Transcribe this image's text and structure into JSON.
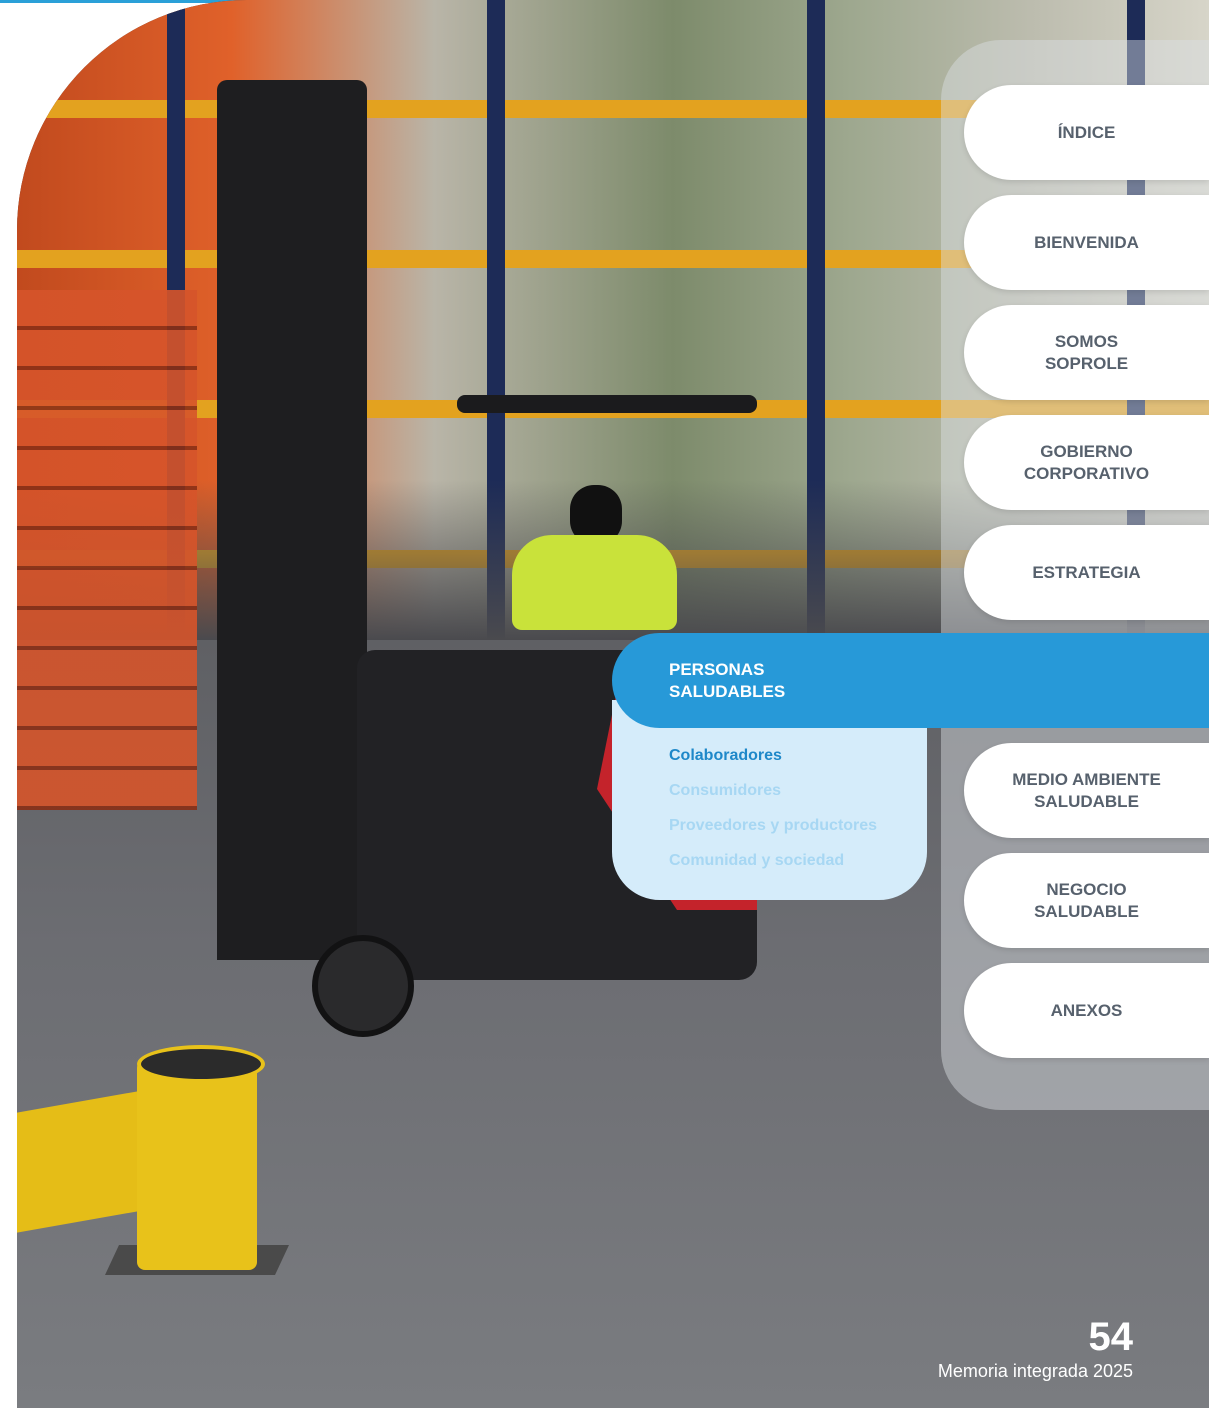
{
  "nav": {
    "items": [
      {
        "label": "ÍNDICE"
      },
      {
        "label": "BIENVENIDA"
      },
      {
        "label": "SOMOS\nSOPROLE"
      },
      {
        "label": "GOBIERNO\nCORPORATIVO"
      },
      {
        "label": "ESTRATEGIA"
      },
      {
        "label": "MEDIO AMBIENTE\nSALUDABLE"
      },
      {
        "label": "NEGOCIO\nSALUDABLE"
      },
      {
        "label": "ANEXOS"
      }
    ],
    "active": {
      "label": "PERSONAS\nSALUDABLES",
      "subitems": [
        {
          "label": "Colaboradores",
          "current": true
        },
        {
          "label": "Consumidores"
        },
        {
          "label": "Proveedores y productores"
        },
        {
          "label": "Comunidad y sociedad"
        }
      ]
    }
  },
  "footer": {
    "page_number": "54",
    "doc_title": "Memoria integrada 2025"
  },
  "colors": {
    "accent": "#2799d8",
    "submenu_bg": "#d5ecfa",
    "submenu_current": "#1e88c9",
    "nav_text": "#57616d"
  }
}
